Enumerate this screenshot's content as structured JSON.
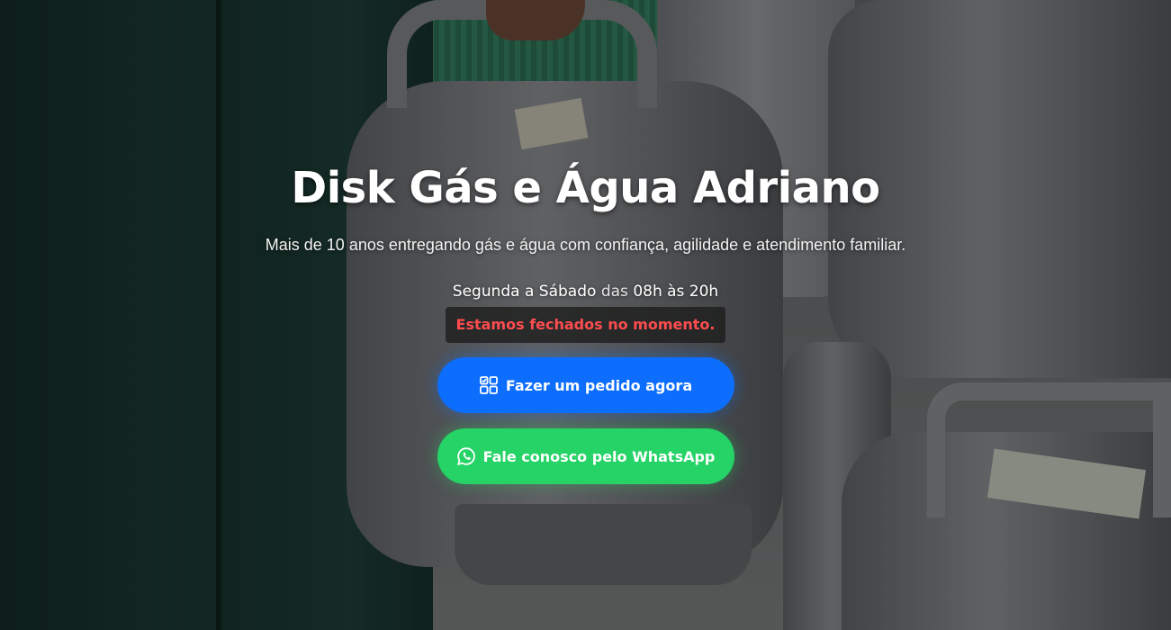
{
  "hero": {
    "title": "Disk Gás e Água Adriano",
    "subtitle": "Mais de 10 anos entregando gás e água com confiança, agilidade e atendimento familiar.",
    "hours": {
      "days": "Segunda a Sábado",
      "connector": "das",
      "time": "08h às 20h"
    },
    "status": "Estamos fechados no momento.",
    "buttons": {
      "order": {
        "label": "Fazer um pedido agora",
        "icon": "grid-check-icon"
      },
      "whatsapp": {
        "label": "Fale conosco pelo WhatsApp",
        "icon": "whatsapp-icon"
      }
    }
  },
  "colors": {
    "order_button": "#0d6efd",
    "whatsapp_button": "#25d366",
    "status_text": "#ff4d4f"
  }
}
